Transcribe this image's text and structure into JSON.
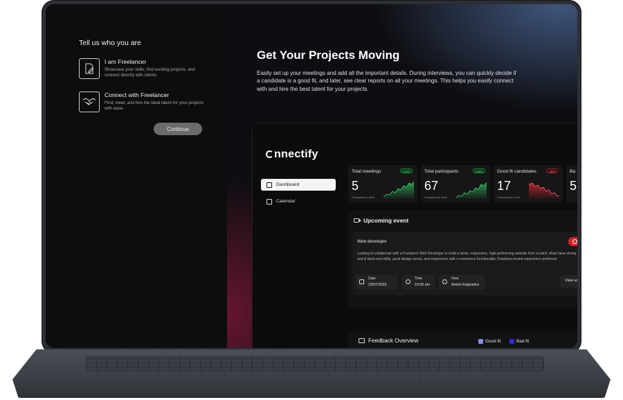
{
  "onboarding": {
    "title": "Tell us who you are",
    "options": [
      {
        "name": "I am Freelancer",
        "description": "Showcase your skills, find exciting projects, and connect directly with clients.",
        "icon": "document-pen-icon"
      },
      {
        "name": "Connect with Freelancer",
        "description": "Find, meet, and hire the ideal talent for your projects with ease.",
        "icon": "handshake-icon"
      }
    ],
    "continue_label": "Continue"
  },
  "hero": {
    "title": "Get Your Projects Moving",
    "description": "Easily set up your meetings and add all the important details. During interviews, you can quickly decide if a candidate is a good fit, and later, see clear reports on all your meetings. This helps you easily connect with and hire the best talent for your projects."
  },
  "app": {
    "logo": "nnectify",
    "nav": [
      {
        "label": "Dashboard",
        "active": true
      },
      {
        "label": "Calendar",
        "active": false
      }
    ],
    "stats": [
      {
        "label": "Total meetings",
        "badge": "+12%",
        "trend": "up",
        "value": "5",
        "sub": "Compared to June"
      },
      {
        "label": "Total participants",
        "badge": "+15%",
        "trend": "up",
        "value": "67",
        "sub": "Compared to June"
      },
      {
        "label": "Good fit candidates",
        "badge": "-10%",
        "trend": "down",
        "value": "17",
        "sub": "Compared to June"
      },
      {
        "label": "Ba",
        "badge": "",
        "trend": "",
        "value": "5",
        "sub": ""
      }
    ],
    "upcoming": {
      "title": "Upcoming event",
      "role": "Web developer",
      "description": "Looking to collaborate with a Freelance Web Developer to build a sleek, responsive, high-performing website from scratch. Must have strong front-end & back-end skills, good design sense, and experience with e-commerce functionality. Freelance brand experience preferred.",
      "date_label": "Date",
      "date_value": "23/07/2025",
      "time_label": "Time",
      "time_value": "10:00 am",
      "host_label": "Host",
      "host_value": "Amish Kajavadra",
      "view_label": "View ev"
    },
    "feedback": {
      "title": "Feedback Overview",
      "legend": [
        {
          "label": "Good fit",
          "color": "#8b87f0"
        },
        {
          "label": "Bad fit",
          "color": "#2a2ad8"
        }
      ]
    }
  },
  "colors": {
    "positive": "#35d46a",
    "negative": "#ff5a66",
    "accent_red": "#d91e27"
  }
}
